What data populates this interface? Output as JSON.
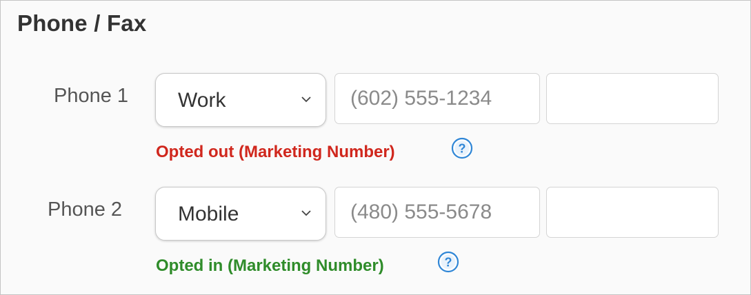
{
  "section": {
    "title": "Phone / Fax"
  },
  "phones": [
    {
      "label": "Phone 1",
      "type": "Work",
      "number_placeholder": "(602) 555-1234",
      "extension_value": "",
      "status": "Opted out (Marketing Number)",
      "status_kind": "opted-out"
    },
    {
      "label": "Phone 2",
      "type": "Mobile",
      "number_placeholder": "(480) 555-5678",
      "extension_value": "",
      "status": "Opted in (Marketing Number)",
      "status_kind": "opted-in"
    }
  ],
  "icons": {
    "help": "question-circle-icon",
    "dropdown": "chevron-down-icon"
  },
  "colors": {
    "opted_out": "#d0271d",
    "opted_in": "#2f8c2a",
    "help_icon": "#2f86d6"
  }
}
